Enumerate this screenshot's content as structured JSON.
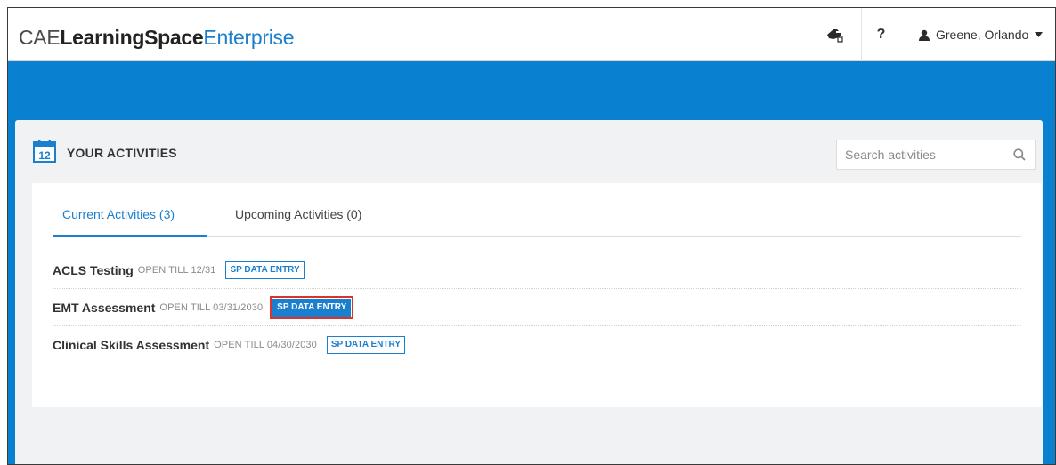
{
  "brand": {
    "part1": "CAE",
    "part2": "LearningSpace",
    "part3": "Enterprise"
  },
  "header": {
    "icons": [
      "hand-pointer-icon",
      "help-icon",
      "user-icon",
      "caret-down-icon"
    ],
    "help_label": "?",
    "user_name": "Greene, Orlando"
  },
  "activities": {
    "title": "YOUR ACTIVITIES",
    "calendar_day": "12",
    "search": {
      "placeholder": "Search activities",
      "value": ""
    },
    "tabs": [
      {
        "label": "Current Activities (3)",
        "active": true
      },
      {
        "label": "Upcoming Activities (0)",
        "active": false
      }
    ],
    "items": [
      {
        "name": "ACLS Testing",
        "open_till": "OPEN TILL 12/31",
        "badge": "SP DATA ENTRY",
        "highlighted": false
      },
      {
        "name": "EMT Assessment",
        "open_till": "OPEN TILL 03/31/2030",
        "badge": "SP DATA ENTRY",
        "highlighted": true
      },
      {
        "name": "Clinical Skills Assessment",
        "open_till": "OPEN TILL 04/30/2030",
        "badge": "SP DATA ENTRY",
        "highlighted": false
      }
    ]
  },
  "colors": {
    "accent": "#1a7fce",
    "header_band": "#0a80d0",
    "highlight_outline": "#d9342b"
  }
}
